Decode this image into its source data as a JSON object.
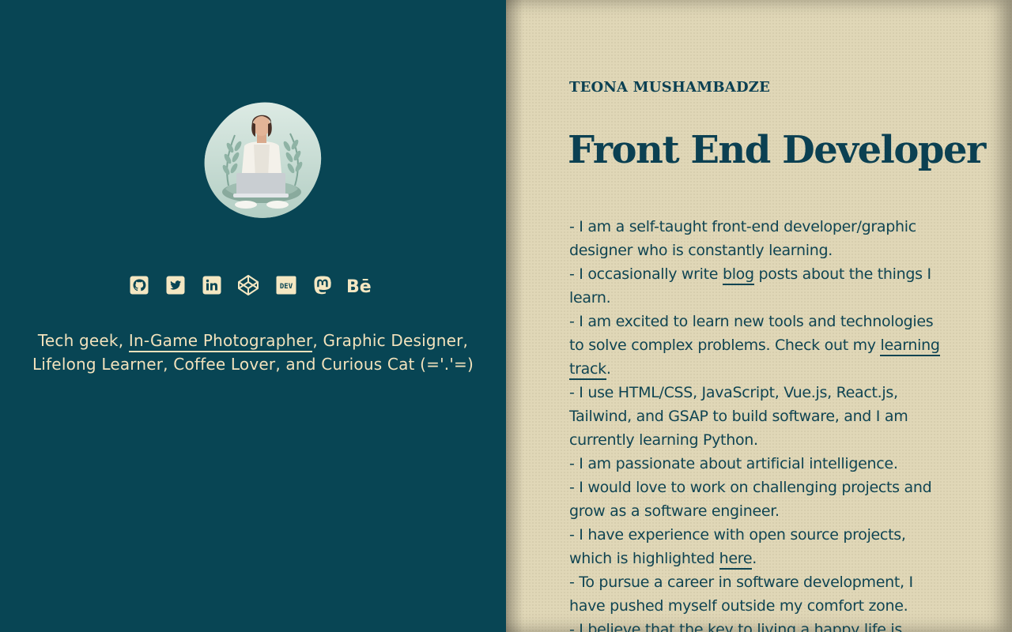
{
  "profile": {
    "name": "TEONA MUSHAMBADZE",
    "headline": "Front End Developer",
    "avatar_alt": "Illustration of a woman sitting cross-legged with a laptop"
  },
  "social": [
    {
      "name": "github-icon",
      "label": "GitHub"
    },
    {
      "name": "twitter-icon",
      "label": "Twitter"
    },
    {
      "name": "linkedin-icon",
      "label": "LinkedIn"
    },
    {
      "name": "codepen-icon",
      "label": "CodePen"
    },
    {
      "name": "dev-icon",
      "label": "DEV"
    },
    {
      "name": "mastodon-icon",
      "label": "Mastodon"
    },
    {
      "name": "behance-icon",
      "label": "Behance"
    }
  ],
  "tagline": {
    "before": "Tech geek, ",
    "link": "In-Game Photographer",
    "after": ", Graphic Designer, Lifelong Learner, Coffee Lover, and Curious Cat (='.'=)"
  },
  "bio": {
    "l1": "- I am a self-taught front-end developer/graphic designer who is constantly learning.",
    "l2_before": "- I occasionally write ",
    "l2_link": "blog",
    "l2_after": " posts about the things I learn.",
    "l3_before": "- I am excited to learn new tools and technologies to solve complex problems. Check out my ",
    "l3_link": "learning track",
    "l3_after": ".",
    "l4": "- I use HTML/CSS, JavaScript, Vue.js, React.js, Tailwind, and GSAP to build software, and I am currently learning Python.",
    "l5": "- I am passionate about artificial intelligence.",
    "l6": "- I would love to work on challenging projects and grow as a software engineer.",
    "l7_before": "- I have experience with open source projects, which is highlighted ",
    "l7_link": "here",
    "l7_after": ".",
    "l8": "- To pursue a career in software development, I have pushed myself outside my comfort zone.",
    "l9": "- I believe that the key to living a happy life is"
  },
  "colors": {
    "left_bg": "#084554",
    "right_bg": "#e0d7b7",
    "accent": "#f2e2bc",
    "heading": "#0b4052"
  }
}
